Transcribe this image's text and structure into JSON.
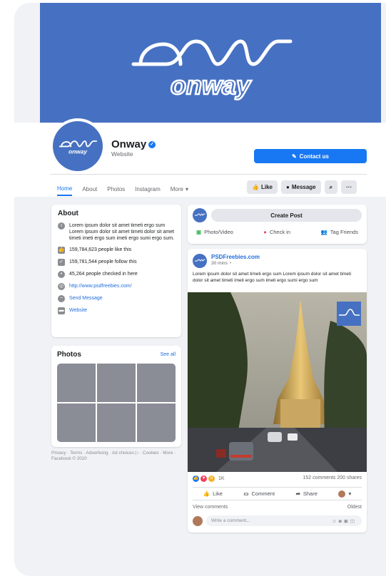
{
  "cover": {
    "logo_word": "onway",
    "brand_color": "#4671c2"
  },
  "profile": {
    "name": "Onway",
    "category": "Website",
    "contact_label": "Contact us"
  },
  "tabs": [
    {
      "label": "Home",
      "active": true
    },
    {
      "label": "About"
    },
    {
      "label": "Photos"
    },
    {
      "label": "Instagram"
    },
    {
      "label": "More"
    }
  ],
  "actions": {
    "like": "Like",
    "message": "Message"
  },
  "about": {
    "title": "About",
    "description": "Lorem ipsum dolor sit amet timeti ergo sum Lorem ipsum dolor sit amet timeti dolor sit amet timeti imeti ergo sum imeti ergo sumi ergo sum.",
    "likes": "159,784,623 people like this",
    "follows": "159,781,544 people follow this",
    "checkins": "45,264 people checked in here",
    "url": "http://www.psdfreebies.com/",
    "send_message": "Send Message",
    "website": "Website"
  },
  "photos": {
    "title": "Photos",
    "see_all": "See all"
  },
  "footer": "Privacy · Terms · Advertising · Ad choices ▷ · Cookies · More · Facebook © 2020",
  "create_post": {
    "label": "Create Post",
    "photo_video": "Photo/Video",
    "check_in": "Check in",
    "tag_friends": "Tag Friends"
  },
  "post": {
    "author": "PSDFreebies.com",
    "time": "30 mins",
    "text": "Lorem ipsum dolor sit amet timeti ergo sum Lorem ipsum dolor sit amet timeti dolor sit amet timeti imeti ergo sum imeti ergo sumi ergo sum",
    "reactions_count": "1K",
    "comments_shares": "152 comments  200 shares",
    "like": "Like",
    "comment": "Comment",
    "share": "Share",
    "view_comments": "View comments",
    "sort": "Oldest",
    "comment_placeholder": "Write a comment..."
  },
  "colors": {
    "accent": "#1877f2",
    "link": "#216fdb",
    "page_bg": "#f0f2f5"
  },
  "icons": [
    "info-icon",
    "thumbs-up-icon",
    "follow-icon",
    "location-pin-icon",
    "globe-icon",
    "messenger-icon",
    "website-icon",
    "search-icon",
    "more-dots-icon",
    "pencil-icon",
    "photo-icon",
    "checkin-icon",
    "tag-friends-icon",
    "clock-globe-icon"
  ]
}
